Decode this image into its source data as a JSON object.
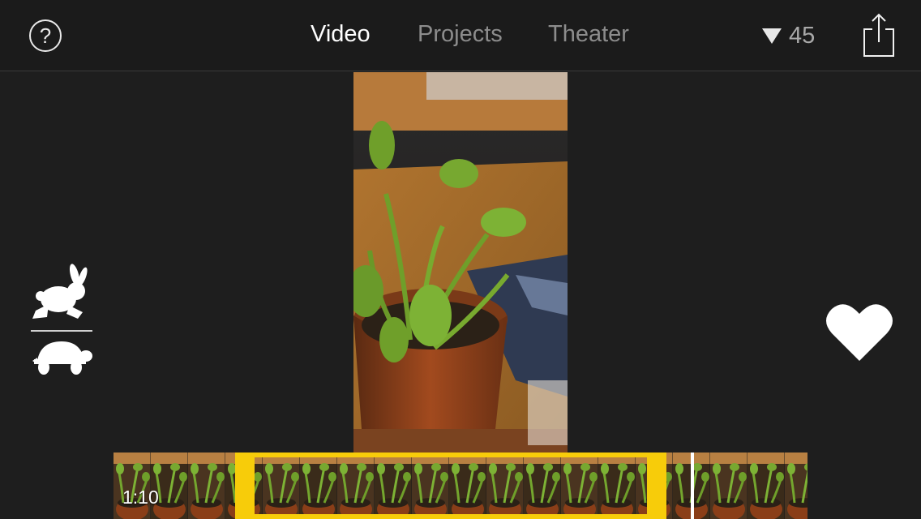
{
  "header": {
    "help_icon_glyph": "?",
    "tabs": [
      {
        "label": "Video",
        "active": true
      },
      {
        "label": "Projects",
        "active": false
      },
      {
        "label": "Theater",
        "active": false
      }
    ],
    "storage_count": "45",
    "share_icon": "share-icon"
  },
  "speed": {
    "fast_icon": "rabbit-icon",
    "slow_icon": "turtle-icon"
  },
  "favorite_icon": "heart-icon",
  "timeline": {
    "duration": "1:10",
    "selection_color": "#f7cc0a"
  },
  "colors": {
    "background": "#1e1e1e",
    "active_tab": "#ffffff",
    "inactive_tab": "#8c8c8c",
    "selection": "#f7cc0a"
  }
}
